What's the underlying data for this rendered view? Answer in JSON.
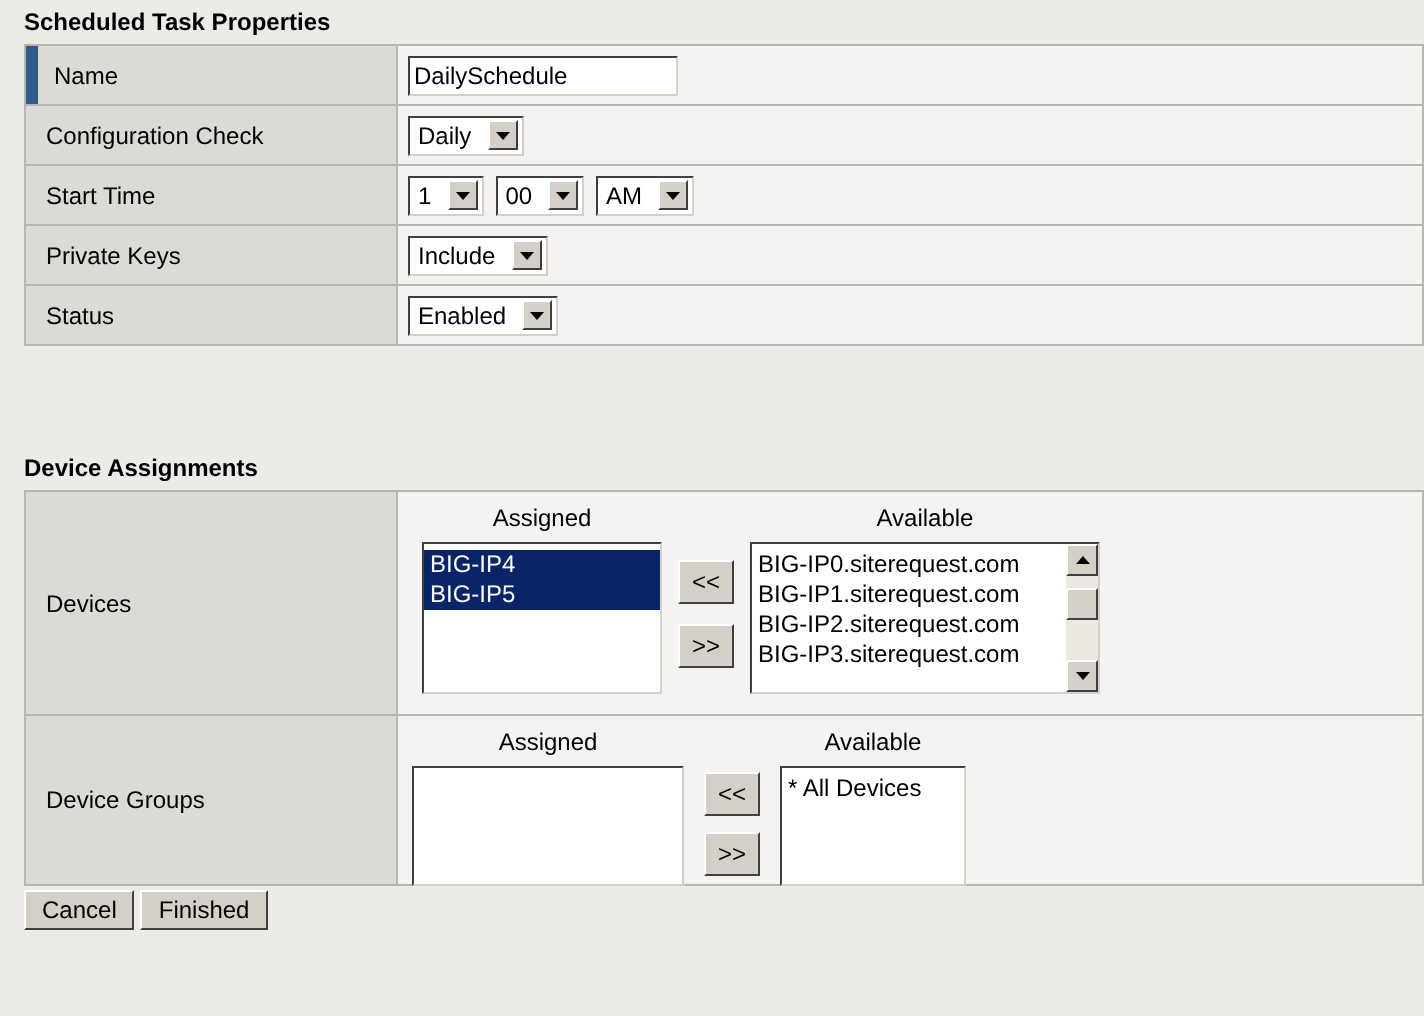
{
  "properties": {
    "title": "Scheduled Task Properties",
    "rows": [
      {
        "label": "Name",
        "selected": true,
        "kind": "text",
        "value": "DailySchedule"
      },
      {
        "label": "Configuration Check",
        "selected": false,
        "kind": "select",
        "selects": [
          "Daily"
        ]
      },
      {
        "label": "Start Time",
        "selected": false,
        "kind": "select",
        "selects": [
          "1",
          "00",
          "AM"
        ]
      },
      {
        "label": "Private Keys",
        "selected": false,
        "kind": "select",
        "selects": [
          "Include"
        ]
      },
      {
        "label": "Status",
        "selected": false,
        "kind": "select",
        "selects": [
          "Enabled"
        ]
      }
    ]
  },
  "assignments": {
    "title": "Device Assignments",
    "rows": [
      {
        "label": "Devices",
        "assigned_heading": "Assigned",
        "available_heading": "Available",
        "remove_button": "<<",
        "add_button": ">>",
        "scrollbar": true,
        "assigned": [
          {
            "text": "BIG-IP4",
            "selected": true
          },
          {
            "text": "BIG-IP5",
            "selected": true
          }
        ],
        "available": [
          {
            "text": "BIG-IP0.siterequest.com",
            "selected": false
          },
          {
            "text": "BIG-IP1.siterequest.com",
            "selected": false
          },
          {
            "text": "BIG-IP2.siterequest.com",
            "selected": false
          },
          {
            "text": "BIG-IP3.siterequest.com",
            "selected": false
          }
        ]
      },
      {
        "label": "Device Groups",
        "assigned_heading": "Assigned",
        "available_heading": "Available",
        "remove_button": "<<",
        "add_button": ">>",
        "scrollbar": false,
        "assigned": [],
        "available": [
          {
            "text": "* All Devices",
            "selected": false
          }
        ]
      }
    ]
  },
  "buttons": [
    "Cancel",
    "Finished"
  ]
}
